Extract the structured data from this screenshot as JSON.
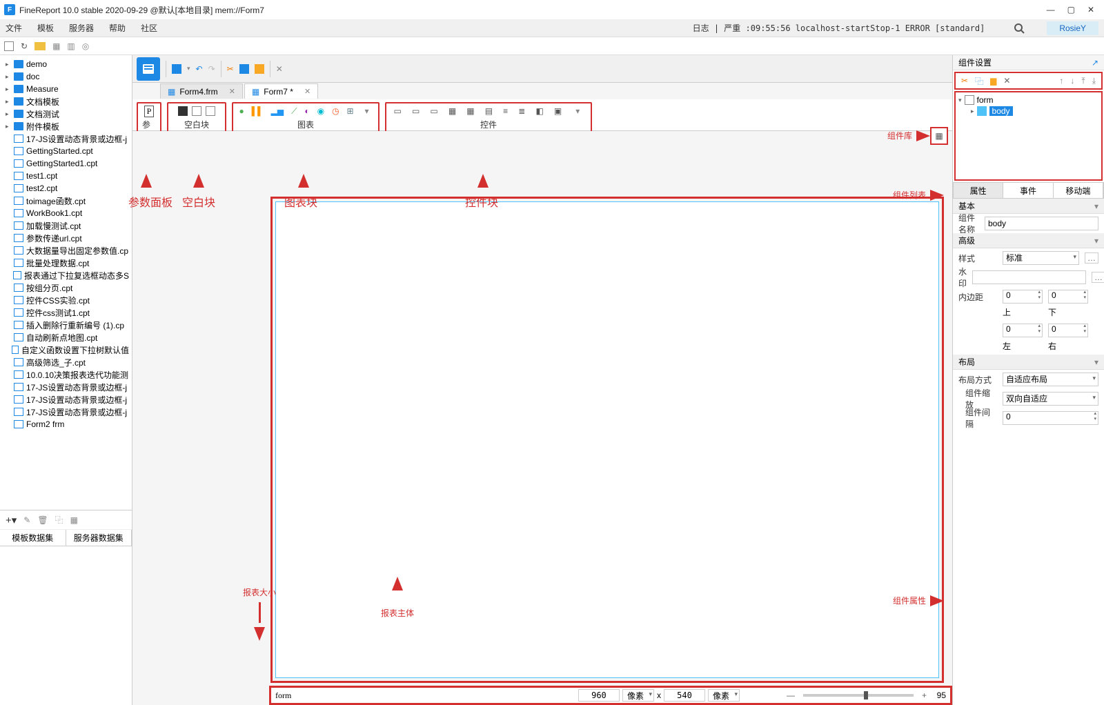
{
  "title": "FineReport 10.0 stable 2020-09-29 @默认[本地目录]   mem://Form7",
  "menus": [
    "文件",
    "模板",
    "服务器",
    "帮助",
    "社区"
  ],
  "log_line": "日志 | 严重 :09:55:56 localhost-startStop-1 ERROR [standard]",
  "user": "RosieY",
  "tree": {
    "folders": [
      "demo",
      "doc",
      "Measure",
      "文档模板",
      "文档测试",
      "附件模板"
    ],
    "files": [
      "17-JS设置动态背景或边框-j",
      "GettingStarted.cpt",
      "GettingStarted1.cpt",
      "test1.cpt",
      "test2.cpt",
      "toimage函数.cpt",
      "WorkBook1.cpt",
      "加载慢测试.cpt",
      "参数传递url.cpt",
      "大数据量导出固定参数值.cp",
      "批量处理数据.cpt",
      "报表通过下拉复选框动态多S",
      "按组分页.cpt",
      "控件CSS实验.cpt",
      "控件css测试1.cpt",
      "插入删除行重新编号 (1).cp",
      "自动刷新点地图.cpt",
      "自定义函数设置下拉树默认值",
      "高级筛选_子.cpt",
      "10.0.10决策报表迭代功能测",
      "17-JS设置动态背景或边框-j",
      "17-JS设置动态背景或边框-j",
      "17-JS设置动态背景或边框-j",
      "Form2 frm"
    ]
  },
  "dataset_tabs": [
    "模板数据集",
    "服务器数据集"
  ],
  "doc_tabs": [
    {
      "label": "Form4.frm",
      "active": false
    },
    {
      "label": "Form7 *",
      "active": true
    }
  ],
  "palette": {
    "param": "参数",
    "blank": "空白块",
    "chart": "图表",
    "widget": "控件"
  },
  "annotations": {
    "param_panel": "参数面板",
    "blank_block": "空白块",
    "chart_block": "图表块",
    "widget_block": "控件块",
    "comp_lib": "组件库",
    "comp_list": "组件列表",
    "report_size": "报表大小",
    "report_body": "报表主体",
    "comp_prop": "组件属性"
  },
  "right": {
    "header": "组件设置",
    "root": "form",
    "child": "body",
    "tabs": [
      "属性",
      "事件",
      "移动端"
    ],
    "sec_basic": "基本",
    "name_lbl": "组件名称",
    "name_val": "body",
    "sec_adv": "高级",
    "style_lbl": "样式",
    "style_val": "标准",
    "water_lbl": "水印",
    "water_val": "",
    "pad_lbl": "内边距",
    "pad_top": "0",
    "pad_top_l": "上",
    "pad_right": "0",
    "pad_right_l": "下",
    "pad_left": "0",
    "pad_left_l": "左",
    "pad_bottom": "0",
    "pad_bottom_l": "右",
    "sec_layout": "布局",
    "layout_mode_lbl": "布局方式",
    "layout_mode_val": "自适应布局",
    "scale_lbl": "组件缩放",
    "scale_val": "双向自适应",
    "gap_lbl": "组件间隔",
    "gap_val": "0"
  },
  "status": {
    "name": "form",
    "w": "960",
    "w_unit": "像素",
    "x": "x",
    "h": "540",
    "h_unit": "像素",
    "zoom": "95"
  }
}
